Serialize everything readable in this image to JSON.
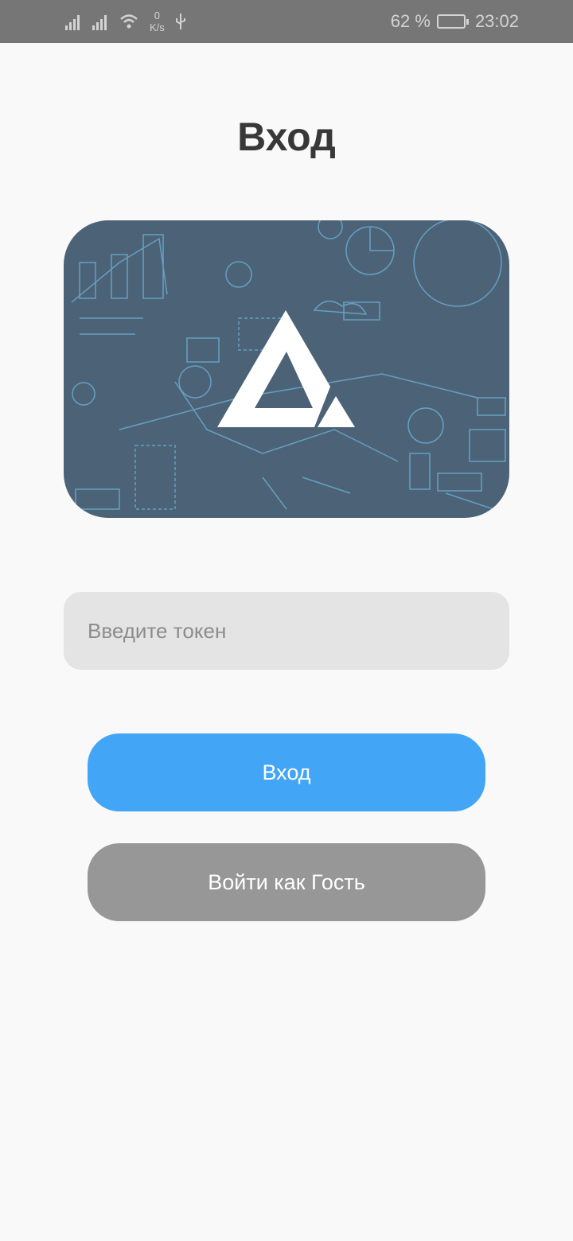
{
  "status_bar": {
    "speed_value": "0",
    "speed_unit": "K/s",
    "battery": "62 %",
    "time": "23:02"
  },
  "title": "Вход",
  "token_input": {
    "placeholder": "Введите токен",
    "value": ""
  },
  "login_button": "Вход",
  "guest_button": "Войти как Гость",
  "colors": {
    "accent": "#42a5f5",
    "secondary": "#979797",
    "banner": "#4c6377"
  }
}
